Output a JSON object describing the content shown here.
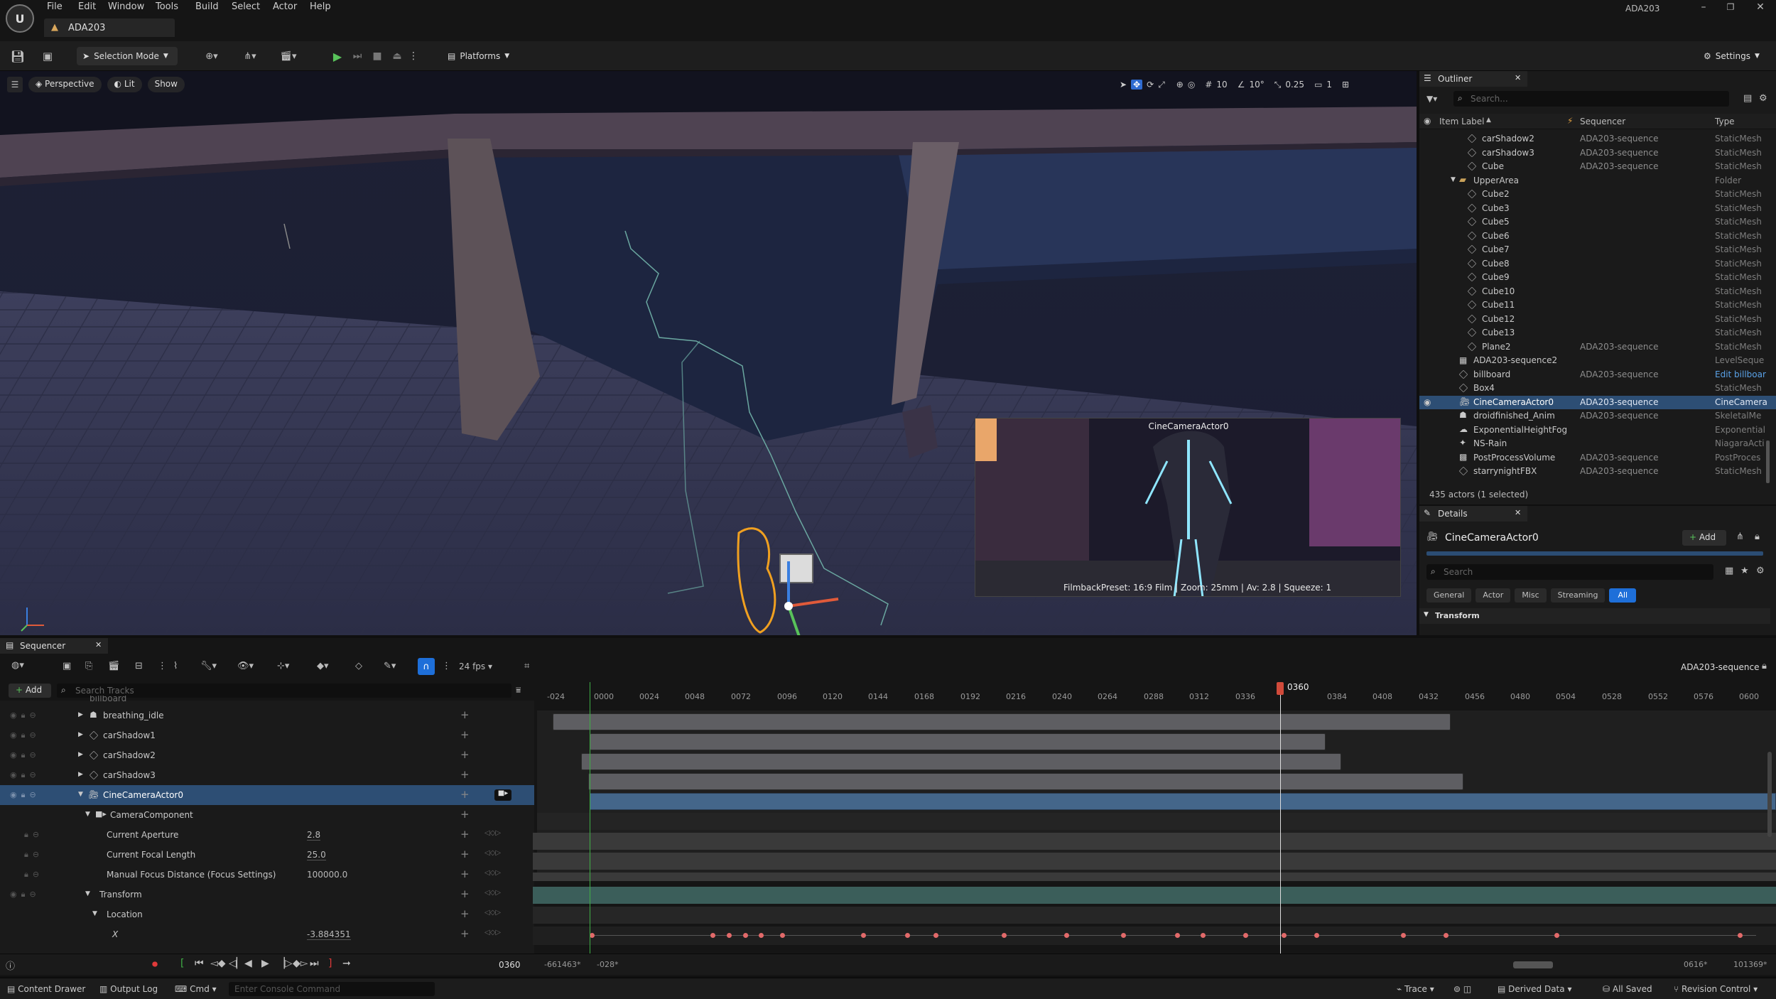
{
  "app": {
    "title": "ADA203",
    "tab_label": "ADA203"
  },
  "menu": [
    "File",
    "Edit",
    "Window",
    "Tools",
    "Build",
    "Select",
    "Actor",
    "Help"
  ],
  "toolbar": {
    "selection_mode": "Selection Mode",
    "platforms": "Platforms",
    "settings": "Settings"
  },
  "viewport": {
    "perspective": "Perspective",
    "lit": "Lit",
    "show": "Show",
    "grid_snap": "10",
    "rot_snap": "10°",
    "scale_snap": "0.25",
    "camera_speed": "1",
    "pip_title": "CineCameraActor0",
    "pip_caption": "FilmbackPreset: 16:9 Film | Zoom: 25mm | Av: 2.8 | Squeeze: 1"
  },
  "outliner": {
    "title": "Outliner",
    "search_placeholder": "Search...",
    "columns": {
      "label": "Item Label",
      "sequencer": "Sequencer",
      "type": "Type"
    },
    "rows": [
      {
        "name": "carShadow2",
        "seq": "ADA203-sequence",
        "type": "StaticMesh"
      },
      {
        "name": "carShadow3",
        "seq": "ADA203-sequence",
        "type": "StaticMesh"
      },
      {
        "name": "Cube",
        "seq": "ADA203-sequence",
        "type": "StaticMesh"
      },
      {
        "name": "UpperArea",
        "seq": "",
        "type": "Folder"
      },
      {
        "name": "Cube2",
        "seq": "",
        "type": "StaticMesh"
      },
      {
        "name": "Cube3",
        "seq": "",
        "type": "StaticMesh"
      },
      {
        "name": "Cube5",
        "seq": "",
        "type": "StaticMesh"
      },
      {
        "name": "Cube6",
        "seq": "",
        "type": "StaticMesh"
      },
      {
        "name": "Cube7",
        "seq": "",
        "type": "StaticMesh"
      },
      {
        "name": "Cube8",
        "seq": "",
        "type": "StaticMesh"
      },
      {
        "name": "Cube9",
        "seq": "",
        "type": "StaticMesh"
      },
      {
        "name": "Cube10",
        "seq": "",
        "type": "StaticMesh"
      },
      {
        "name": "Cube11",
        "seq": "",
        "type": "StaticMesh"
      },
      {
        "name": "Cube12",
        "seq": "",
        "type": "StaticMesh"
      },
      {
        "name": "Cube13",
        "seq": "",
        "type": "StaticMesh"
      },
      {
        "name": "Plane2",
        "seq": "ADA203-sequence",
        "type": "StaticMesh"
      },
      {
        "name": "ADA203-sequence2",
        "seq": "",
        "type": "LevelSeque"
      },
      {
        "name": "billboard",
        "seq": "ADA203-sequence",
        "type": "Edit billboar"
      },
      {
        "name": "Box4",
        "seq": "",
        "type": "StaticMesh"
      },
      {
        "name": "CineCameraActor0",
        "seq": "ADA203-sequence",
        "type": "CineCamera"
      },
      {
        "name": "droidfinished_Anim",
        "seq": "ADA203-sequence",
        "type": "SkeletalMe"
      },
      {
        "name": "ExponentialHeightFog",
        "seq": "",
        "type": "Exponential"
      },
      {
        "name": "NS-Rain",
        "seq": "",
        "type": "NiagaraActi"
      },
      {
        "name": "PostProcessVolume",
        "seq": "ADA203-sequence",
        "type": "PostProces"
      },
      {
        "name": "starrynightFBX",
        "seq": "ADA203-sequence",
        "type": "StaticMesh"
      }
    ],
    "footer": "435 actors (1 selected)"
  },
  "details": {
    "title": "Details",
    "actor": "CineCameraActor0",
    "add": "Add",
    "search_placeholder": "Search",
    "filters": [
      "General",
      "Actor",
      "Misc",
      "Streaming",
      "All"
    ],
    "section": "Transform"
  },
  "sequencer": {
    "title": "Sequencer",
    "add": "Add",
    "search_placeholder": "Search Tracks",
    "fps": "24 fps",
    "sequence_name": "ADA203-sequence",
    "playhead_label": "0360",
    "ruler": [
      "-024",
      "0000",
      "0024",
      "0048",
      "0072",
      "0096",
      "0120",
      "0144",
      "0168",
      "0192",
      "0216",
      "0240",
      "0264",
      "0288",
      "0312",
      "0336",
      "0384",
      "0408",
      "0432",
      "0456",
      "0480",
      "0504",
      "0528",
      "0552",
      "0576",
      "0600"
    ],
    "tracks": [
      {
        "label": "billboard",
        "value": ""
      },
      {
        "label": "breathing_idle",
        "value": ""
      },
      {
        "label": "carShadow1",
        "value": ""
      },
      {
        "label": "carShadow2",
        "value": ""
      },
      {
        "label": "carShadow3",
        "value": ""
      },
      {
        "label": "CineCameraActor0",
        "value": ""
      },
      {
        "label": "CameraComponent",
        "value": ""
      },
      {
        "label": "Current Aperture",
        "value": "2.8"
      },
      {
        "label": "Current Focal Length",
        "value": "25.0"
      },
      {
        "label": "Manual Focus Distance (Focus Settings)",
        "value": "100000.0"
      },
      {
        "label": "Transform",
        "value": ""
      },
      {
        "label": "Location",
        "value": ""
      },
      {
        "label": "X",
        "value": "-3.884351"
      }
    ],
    "current_frame": "0360",
    "range_start": "-661463*",
    "range_start2": "-028*",
    "range_end": "0616*",
    "range_end2": "101369*"
  },
  "statusbar": {
    "content_drawer": "Content Drawer",
    "output_log": "Output Log",
    "cmd": "Cmd",
    "console_placeholder": "Enter Console Command",
    "trace": "Trace",
    "derived_data": "Derived Data",
    "all_saved": "All Saved",
    "revision_control": "Revision Control"
  }
}
